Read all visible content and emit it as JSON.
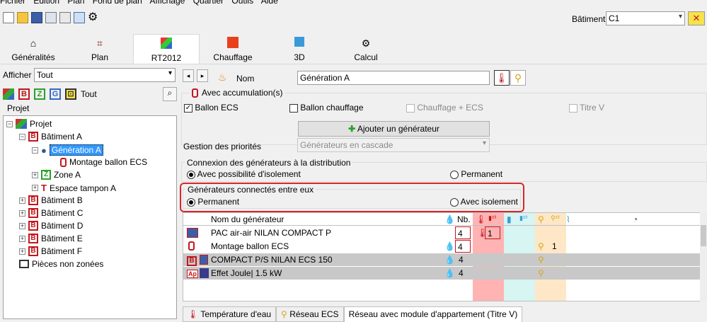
{
  "menu": [
    "Fichier",
    "Edition",
    "Plan",
    "Fond de plan",
    "Affichage",
    "Quartier",
    "Outils",
    "Aide"
  ],
  "toolbar_icons": [
    "new-file-icon",
    "open-folder-icon",
    "save-icon",
    "list-icon",
    "network-icon",
    "table-icon",
    "gear-icon"
  ],
  "batiment": {
    "label": "Bâtiment",
    "value": "C1"
  },
  "tabs": [
    {
      "label": "Généralités",
      "icon": "home-icon"
    },
    {
      "label": "Plan",
      "icon": "plan-icon"
    },
    {
      "label": "RT2012",
      "icon": "rt2012-icon"
    },
    {
      "label": "Chauffage",
      "icon": "heating-house-icon"
    },
    {
      "label": "3D",
      "icon": "cube-icon"
    },
    {
      "label": "Calcul",
      "icon": "gears-icon"
    }
  ],
  "left": {
    "afficher_label": "Afficher",
    "afficher_value": "Tout",
    "filter_tout": "Tout",
    "projet_header": "Projet",
    "tree": {
      "projet": "Projet",
      "batiment_a": "Bâtiment A",
      "generation_a": "Génération A",
      "montage": "Montage ballon ECS",
      "zone_a": "Zone A",
      "espace_tampon": "Espace tampon A",
      "batiment_b": "Bâtiment B",
      "batiment_c": "Bâtiment C",
      "batiment_d": "Bâtiment D",
      "batiment_e": "Bâtiment E",
      "batiment_f": "Bâtiment F",
      "pieces": "Pièces non zonées"
    }
  },
  "right": {
    "nom_label": "Nom",
    "nom_value": "Génération A",
    "avec_accumulation": "Avec accumulation(s)",
    "ballon_ecs": "Ballon ECS",
    "ballon_chauffage": "Ballon chauffage",
    "chauffage_ecs": "Chauffage + ECS",
    "titre_v": "Titre V",
    "ajouter": "Ajouter un générateur",
    "gestion_label": "Gestion des priorités",
    "gestion_value": "Générateurs en cascade",
    "connexion_title": "Connexion des générateurs à la distribution",
    "connexion_opt1": "Avec possibilité d'isolement",
    "connexion_opt2": "Permanent",
    "connectes_title": "Générateurs connectés entre eux",
    "connectes_opt1": "Permanent",
    "connectes_opt2": "Avec isolement",
    "grid_header": {
      "nom": "Nom du générateur",
      "nb": "Nb."
    },
    "rows": [
      {
        "nom": "PAC air-air NILAN COMPACT P",
        "nb": "4",
        "c1": "1",
        "c2": ""
      },
      {
        "nom": "Montage ballon ECS",
        "nb": "4",
        "c1": "",
        "c2": "1"
      },
      {
        "nom": "COMPACT P/S NILAN ECS 150",
        "nb": "4",
        "c1": "",
        "c2": ""
      },
      {
        "nom": "Effet Joule| 1.5 kW",
        "nb": "4",
        "c1": "",
        "c2": ""
      }
    ],
    "bottom_tabs": [
      "Température d'eau",
      "Réseau ECS",
      "Réseau avec module d'appartement (Titre V)"
    ]
  },
  "colors": {
    "accent": "#3399ff",
    "highlight_red": "#d9262c",
    "pink_col": "#ffb3b3",
    "cyan_col": "#d6f5f3",
    "tan_col": "#fde7c7"
  }
}
